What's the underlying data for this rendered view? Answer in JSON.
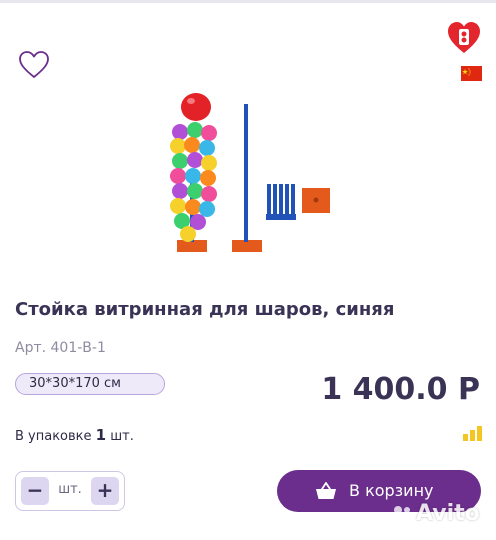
{
  "product": {
    "title": "Стойка витринная для шаров, синяя",
    "article": "Арт. 401-В-1",
    "size_option": "30*30*170 см",
    "price": "1 400.0 Р",
    "pack_prefix": "В упаковке",
    "pack_count": "1",
    "pack_unit": "шт."
  },
  "quantity": {
    "minus": "−",
    "unit": "шт.",
    "plus": "+"
  },
  "cart_button": {
    "label": "В корзину",
    "icon": "basket-icon"
  },
  "icons": {
    "favorite": "heart-outline-icon",
    "brand": "balloon-logo-icon",
    "country": "china-flag-icon",
    "stock": "stock-level-icon"
  },
  "colors": {
    "accent": "#6b2e8c",
    "chip_border": "#b7a6de",
    "chip_bg": "#efeafa",
    "stock_yellow": "#f3c623"
  },
  "watermark": "Avito"
}
